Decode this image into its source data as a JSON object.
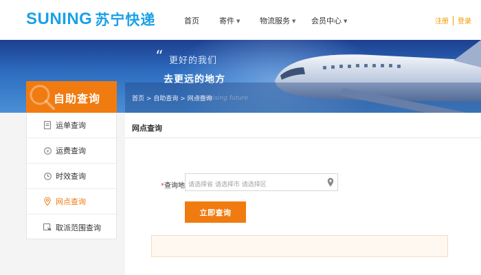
{
  "header": {
    "logo_en": "SUNING",
    "logo_cn": "苏宁快递",
    "nav": [
      {
        "label": "首页",
        "has_dropdown": false
      },
      {
        "label": "寄件",
        "has_dropdown": true
      },
      {
        "label": "物流服务",
        "has_dropdown": true
      },
      {
        "label": "会员中心",
        "has_dropdown": true
      }
    ],
    "register": "注册",
    "login": "登录"
  },
  "banner": {
    "slogan_line1": "更好的我们",
    "slogan_line2": "去更远的地方",
    "slogan_en": "promising future"
  },
  "sidebar": {
    "title": "自助查询",
    "items": [
      {
        "label": "运单查询",
        "icon": "waybill-icon",
        "active": false
      },
      {
        "label": "运费查询",
        "icon": "yen-coin-icon",
        "active": false
      },
      {
        "label": "时效查询",
        "icon": "clock-icon",
        "active": false
      },
      {
        "label": "网点查询",
        "icon": "location-pin-icon",
        "active": true
      },
      {
        "label": "取派范围查询",
        "icon": "range-icon",
        "active": false
      }
    ]
  },
  "breadcrumb": {
    "home": "首页",
    "sep": ">",
    "section": "自助查询",
    "current": "网点查询"
  },
  "main": {
    "title": "网点查询",
    "field_required_mark": "*",
    "field_label": "查询地：",
    "field_placeholder": "请选择省 请选择市 请选择区",
    "submit_label": "立即查询"
  },
  "colors": {
    "brand_blue": "#1aa0e8",
    "accent_orange": "#f07b10"
  }
}
